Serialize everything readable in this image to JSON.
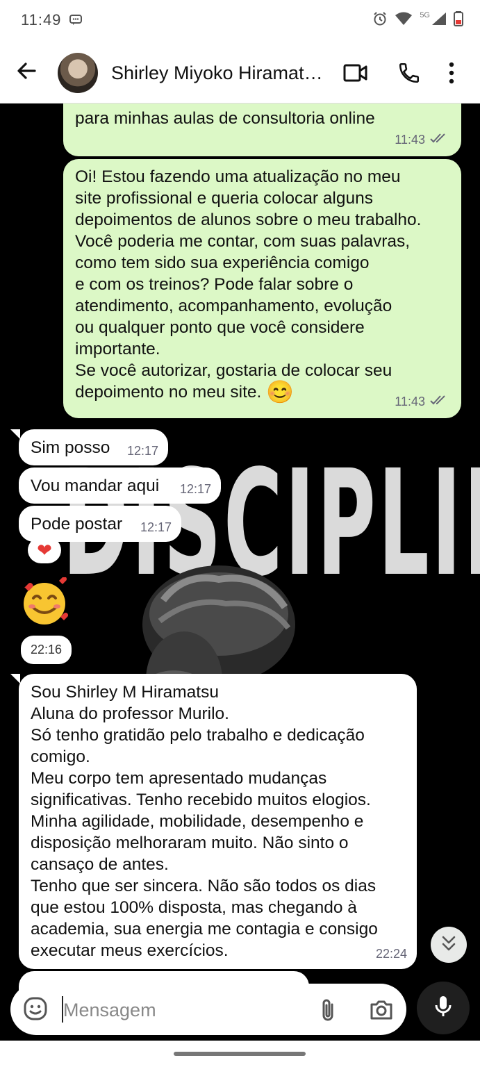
{
  "status": {
    "time": "11:49",
    "network": "5G"
  },
  "header": {
    "contact_name": "Shirley Miyoko Hiramat…"
  },
  "messages": {
    "m1": {
      "text": "para minhas aulas de consultoria online",
      "time": "11:43"
    },
    "m2": {
      "text": "Oi! Estou fazendo uma atualização no meu\nsite profissional e queria colocar alguns\ndepoimentos de alunos sobre o meu trabalho.\nVocê poderia me contar, com suas palavras,\ncomo tem sido sua experiência comigo\ne com os treinos? Pode falar sobre o\natendimento, acompanhamento, evolução\nou qualquer ponto que você considere\nimportante.\nSe você autorizar, gostaria de colocar seu\ndepoimento no meu site.",
      "emoji": "😊",
      "time": "11:43"
    },
    "m3": {
      "text": "Sim posso",
      "time": "12:17"
    },
    "m4": {
      "text": "Vou mandar aqui",
      "time": "12:17"
    },
    "m5": {
      "text": "Pode postar",
      "time": "12:17",
      "reaction": "❤"
    },
    "m6": {
      "emoji": "🥰",
      "time": "22:16"
    },
    "m7": {
      "text": "Sou Shirley M Hiramatsu\nAluna do professor Murilo.\nSó tenho gratidão pelo trabalho e dedicação\ncomigo.\nMeu corpo tem apresentado mudanças\nsignificativas. Tenho recebido muitos elogios.\nMinha agilidade, mobilidade, desempenho e\ndisposição melhoraram muito. Não sinto o\ncansaço de antes.\nTenho que ser sincera. Não são todos os dias\nque estou 100% disposta, mas chegando à\nacademia, sua energia me contagia e consigo\nexecutar meus exercícios.",
      "time": "22:24"
    }
  },
  "wallpaper": {
    "text": "DISCIPLINE"
  },
  "composer": {
    "placeholder": "Mensagem"
  },
  "colors": {
    "outgoing_bubble": "#dcf8c6",
    "incoming_bubble": "#ffffff",
    "chat_background": "#000000"
  },
  "icons": [
    "back-arrow-icon",
    "video-call-icon",
    "phone-icon",
    "more-icon",
    "emoji-icon",
    "attach-icon",
    "camera-icon",
    "mic-icon",
    "double-chevron-down-icon",
    "double-check-icon"
  ]
}
